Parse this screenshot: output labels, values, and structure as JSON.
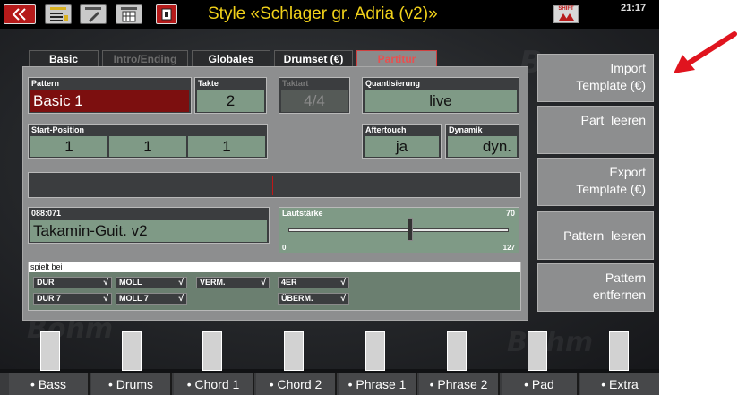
{
  "topbar": {
    "style_title": "Style «Schlager gr. Adria (v2)»",
    "clock": "21:17",
    "shift_label": "SHIFT",
    "icons": [
      "back-double-chevron-icon",
      "menu-icon",
      "edit-icon",
      "registration-bank-icon",
      "stop-icon",
      "shift-icon"
    ]
  },
  "tabs": [
    {
      "label": "Basic",
      "state": "normal"
    },
    {
      "label": "Intro/Ending",
      "state": "disabled"
    },
    {
      "label": "Globales",
      "state": "normal"
    },
    {
      "label": "Drumset (€)",
      "state": "normal"
    },
    {
      "label": "Partitur",
      "state": "active"
    }
  ],
  "fields": {
    "pattern": {
      "label": "Pattern",
      "value": "Basic 1"
    },
    "takte": {
      "label": "Takte",
      "value": "2"
    },
    "taktart": {
      "label": "Taktart",
      "value": "4/4"
    },
    "quantisierung": {
      "label": "Quantisierung",
      "value": "live"
    },
    "start_position": {
      "label": "Start-Position",
      "values": [
        "1",
        "1",
        "1"
      ]
    },
    "aftertouch": {
      "label": "Aftertouch",
      "value": "ja"
    },
    "dynamik": {
      "label": "Dynamik",
      "value": "dyn."
    },
    "sound": {
      "label": "088:071",
      "value": "Takamin-Guit. v2"
    },
    "lautstaerke": {
      "label": "Lautstärke",
      "value": "70",
      "min": "0",
      "max": "127",
      "fraction": 0.551
    }
  },
  "spielt_bei": {
    "label": "spielt bei",
    "options": [
      {
        "label": "DUR",
        "checked": true
      },
      {
        "label": "MOLL",
        "checked": true
      },
      {
        "label": "VERM.",
        "checked": true
      },
      {
        "label": "4ER",
        "checked": true
      },
      {
        "label": "DUR 7",
        "checked": true
      },
      {
        "label": "MOLL 7",
        "checked": true
      },
      {
        "label": "ÜBERM.",
        "checked": true
      }
    ],
    "tick": "√"
  },
  "right_buttons": [
    {
      "line1": "Import",
      "line2": "Template (€)"
    },
    {
      "line1": "Part  leeren",
      "line2": ""
    },
    {
      "line1": "Export",
      "line2": "Template (€)"
    },
    {
      "line1": "Pattern  leeren",
      "line2": ""
    },
    {
      "line1": "Pattern",
      "line2": "entfernen"
    }
  ],
  "bottom_tabs": [
    "• Bass",
    "• Drums",
    "• Chord 1",
    "• Chord 2",
    "• Phrase 1",
    "• Phrase 2",
    "• Pad",
    "• Extra"
  ],
  "colors": {
    "title_yellow": "#f2d21a",
    "active_tab_red": "#e85050",
    "pattern_red": "#7c0f0f",
    "value_green": "#7f9a86",
    "arrow_red": "#e0141e"
  }
}
